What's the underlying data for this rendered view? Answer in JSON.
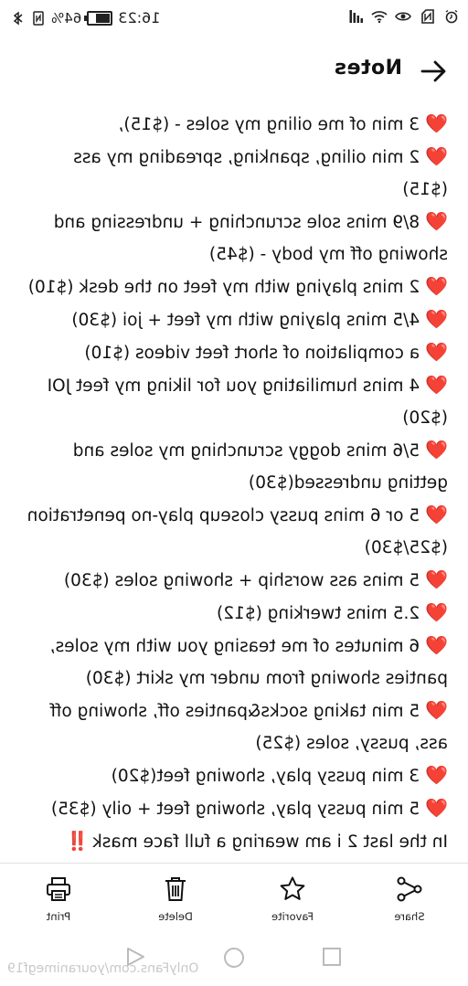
{
  "status_bar": {
    "time": "16:23",
    "battery_percent": "64%",
    "battery_level": 0.64,
    "icons_left": [
      "bluetooth-icon",
      "nfc-icon"
    ],
    "icons_right": [
      "wifi-icon",
      "eye-icon",
      "sim-icon",
      "alarm-icon"
    ]
  },
  "header": {
    "title": "Notes",
    "back_icon": "arrow-left-icon"
  },
  "notes": [
    {
      "heart": true,
      "text": "3 min of me oiling my soles - ($15),"
    },
    {
      "heart": true,
      "text": "2 min oiling, spanking, spreading my ass"
    },
    {
      "heart": false,
      "text": "($15)"
    },
    {
      "heart": true,
      "text": "8/9 mins sole scrunching + undressing and"
    },
    {
      "heart": false,
      "text": "showing off my body - ($45)"
    },
    {
      "heart": true,
      "text": "2 mins playing with my feet on the desk ($10)"
    },
    {
      "heart": true,
      "text": "4/5 mins playing with my feet + joi ($30)"
    },
    {
      "heart": true,
      "text": "a compilation of short feet videos ($10)"
    },
    {
      "heart": true,
      "text": "4 mins humiliating you for liking my feet JOI"
    },
    {
      "heart": false,
      "text": "($20)"
    },
    {
      "heart": true,
      "text": "5/6 mins doggy scrunching my soles and"
    },
    {
      "heart": false,
      "text": "getting undressed($30)"
    },
    {
      "heart": true,
      "text": "5 or 6 mins pussy closeup play-no penetration"
    },
    {
      "heart": false,
      "text": "($25/$30)"
    },
    {
      "heart": true,
      "text": "5 mins ass worship + showing soles ($30)"
    },
    {
      "heart": true,
      "text": "2.5 mins twerking ($12)"
    },
    {
      "heart": true,
      "text": "6 minutes of me teasing you with my soles,"
    },
    {
      "heart": false,
      "text": "panties showing from under my skirt ($30)"
    },
    {
      "heart": true,
      "text": "5 min taking socks&panties off, showing off"
    },
    {
      "heart": false,
      "text": "ass, pussy, soles ($25)"
    },
    {
      "heart": true,
      "text": "3 min pussy play, showing feet($20)"
    },
    {
      "heart": true,
      "text": "5 min pussy play, showing feet + oily ($35)"
    }
  ],
  "final_line": {
    "text": "In the last 2 i am wearing a full face mask",
    "emoji": "‼️"
  },
  "heart_emoji": "❤️",
  "toolbar": {
    "share_label": "Share",
    "favorite_label": "Favorite",
    "delete_label": "Delete",
    "print_label": "Print"
  },
  "watermark": "OnlyFans.com/youranimegf19",
  "colors": {
    "heart": "#d2232a",
    "text": "#111111",
    "background": "#ffffff"
  }
}
